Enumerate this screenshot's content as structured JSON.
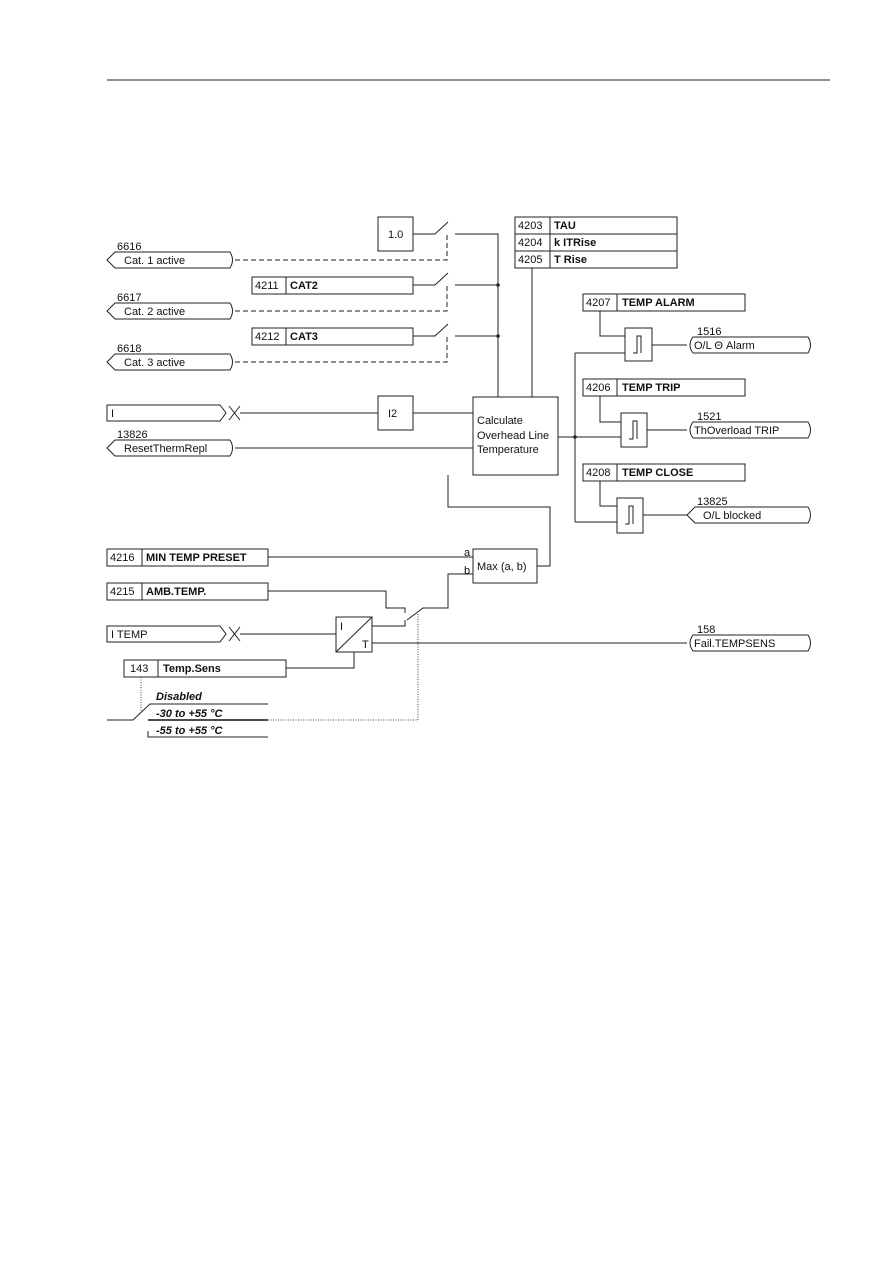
{
  "diagram": {
    "constants": {
      "one": "1.0",
      "i2": "I2"
    },
    "category_settings": [
      {
        "id": "4211",
        "label": "CAT2"
      },
      {
        "id": "4212",
        "label": "CAT3"
      }
    ],
    "category_inputs": [
      {
        "id": "6616",
        "label": "Cat. 1 active"
      },
      {
        "id": "6617",
        "label": "Cat. 2 active"
      },
      {
        "id": "6618",
        "label": "Cat. 3 active"
      }
    ],
    "thermal_params": [
      {
        "id": "4203",
        "label": "TAU"
      },
      {
        "id": "4204",
        "label": "k ITRise"
      },
      {
        "id": "4205",
        "label": "T Rise"
      }
    ],
    "current_input": "I",
    "reset_input": {
      "id": "13826",
      "label": "ResetThermRepl"
    },
    "calc_block": [
      "Calculate",
      "Overhead Line",
      "Temperature"
    ],
    "thresholds": [
      {
        "id": "4207",
        "label": "TEMP ALARM",
        "out_id": "1516",
        "out_label": "O/L Θ Alarm"
      },
      {
        "id": "4206",
        "label": "TEMP TRIP",
        "out_id": "1521",
        "out_label": "ThOverload TRIP"
      },
      {
        "id": "4208",
        "label": "TEMP CLOSE",
        "out_id": "13825",
        "out_label": "O/L blocked"
      }
    ],
    "min_temp": {
      "id": "4216",
      "label": "MIN TEMP PRESET"
    },
    "amb_temp": {
      "id": "4215",
      "label": "AMB.TEMP."
    },
    "max_block": {
      "label": "Max (a, b)",
      "a": "a",
      "b": "b"
    },
    "temp_input": "I TEMP",
    "converter": {
      "in": "I",
      "out": "T"
    },
    "fail_output": {
      "id": "158",
      "label": "Fail.TEMPSENS"
    },
    "temp_sens": {
      "id": "143",
      "label": "Temp.Sens",
      "options": [
        "Disabled",
        "-30 to +55 °C",
        "-55 to +55 °C"
      ]
    }
  }
}
